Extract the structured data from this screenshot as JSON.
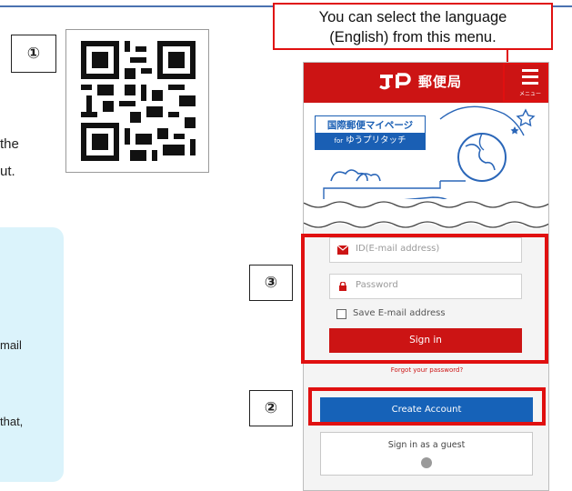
{
  "left_fragments": {
    "line1": "the",
    "line2": "ut.",
    "line3": "mail",
    "line4": "that,"
  },
  "markers": {
    "m1": "①",
    "m2": "②",
    "m3": "③"
  },
  "callout": {
    "line1": "You can select the language",
    "line2": "(English) from this menu."
  },
  "app": {
    "brand": "郵便局",
    "menu_label": "メニュー",
    "badge_title": "国際郵便マイページ",
    "badge_for": "for",
    "badge_sub": "ゆうプリタッチ",
    "email_placeholder": "ID(E-mail address)",
    "password_placeholder": "Password",
    "save_email_label": "Save E-mail address",
    "sign_in_label": "Sign in",
    "forgot_label": "Forgot your password?",
    "create_account_label": "Create Account",
    "guest_label": "Sign in as a guest"
  },
  "colors": {
    "brand_red": "#cc1414",
    "create_blue": "#1662b8",
    "highlight_red": "#e01010",
    "note_bg": "#dbf3fb"
  }
}
